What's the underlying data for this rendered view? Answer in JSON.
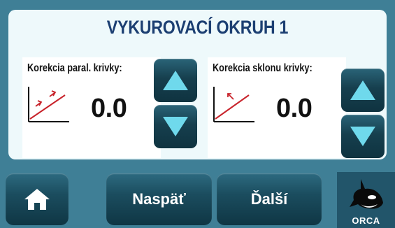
{
  "header": {
    "title": "VYKUROVACÍ OKRUH 1"
  },
  "left_card": {
    "label": "Korekcia paral. krivky:",
    "value": "0.0",
    "graph_icon": "parallel-shift-curve-icon",
    "up_icon": "triangle-up-icon",
    "down_icon": "triangle-down-icon"
  },
  "right_card": {
    "label": "Korekcia sklonu krivky:",
    "value": "0.0",
    "graph_icon": "slope-curve-icon",
    "up_icon": "triangle-up-icon",
    "down_icon": "triangle-down-icon"
  },
  "footer": {
    "home_icon": "home-icon",
    "back_label": "Naspäť",
    "next_label": "Ďalší",
    "logo_text": "ORCA"
  },
  "colors": {
    "background": "#3f7f96",
    "panel": "#eef9fb",
    "title": "#1c3f72",
    "button": "#1b4d5f",
    "graph_line": "#c8232b"
  }
}
